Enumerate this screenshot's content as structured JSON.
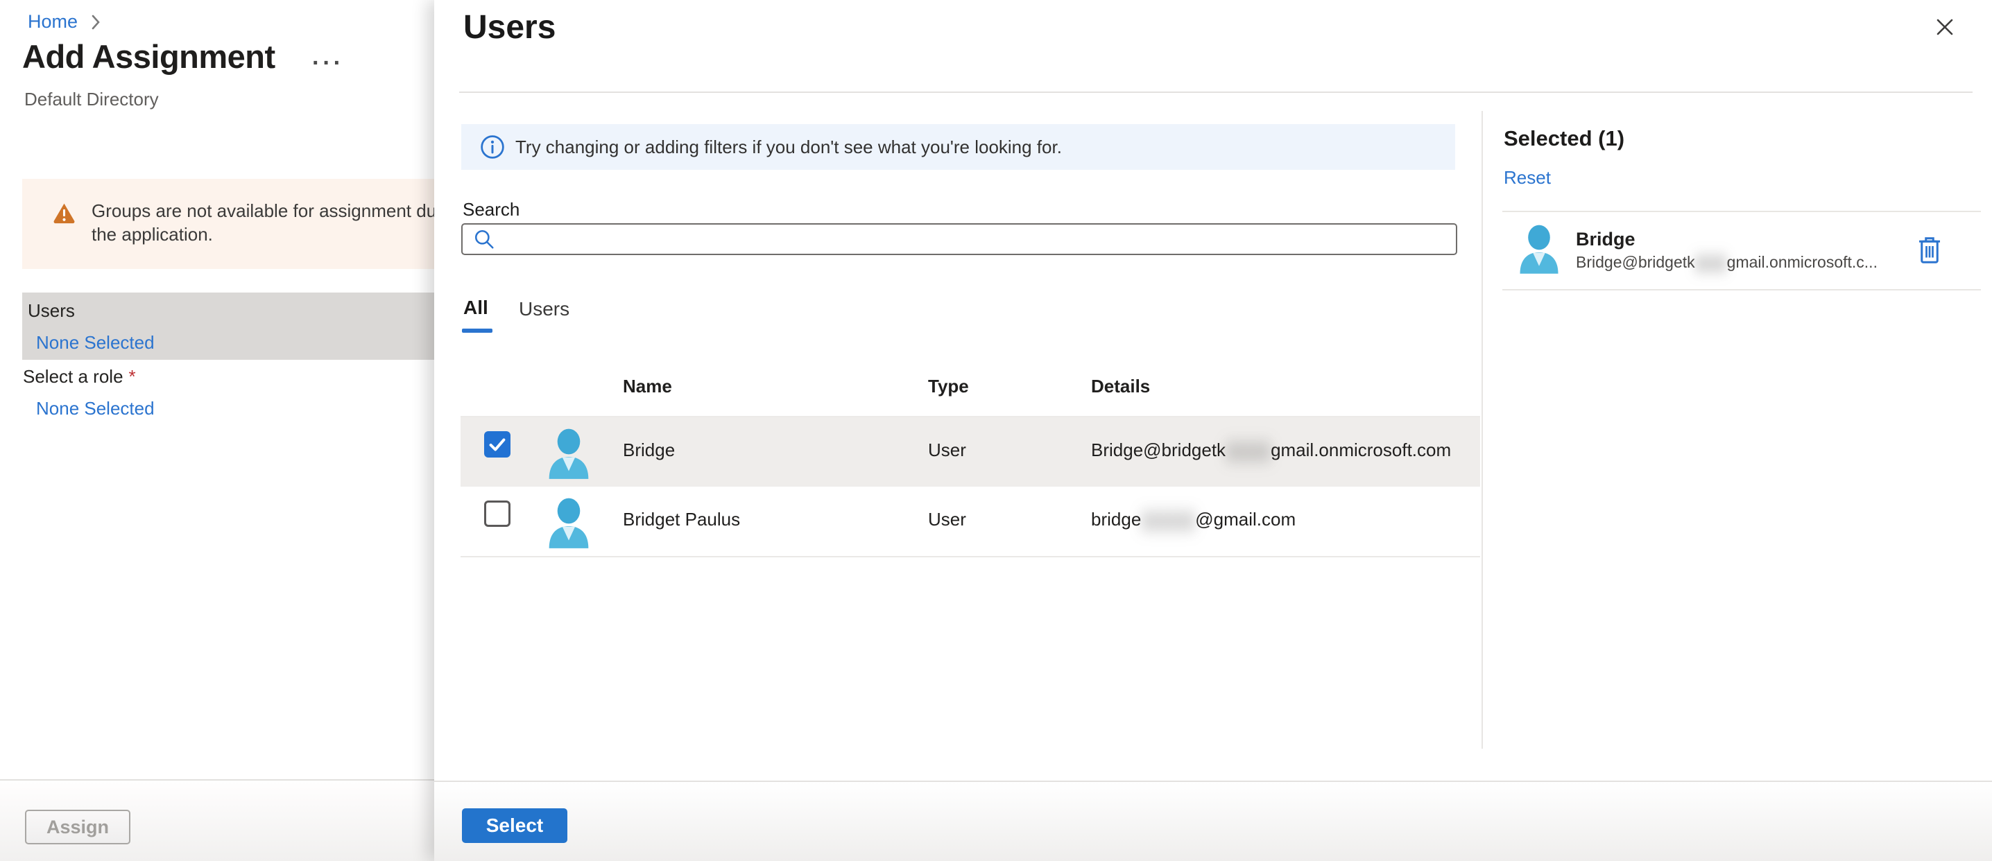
{
  "colors": {
    "accent_link": "#2b74cf",
    "primary_button": "#2374cc",
    "checkbox_checked": "#2272d3",
    "warning_banner_bg": "#fdf3ec",
    "warning_icon": "#cf7428",
    "info_banner_bg": "#eef4fc",
    "selected_row_bg": "#efedeb",
    "selected_field_bg": "#dad8d6",
    "avatar_blue": "#47afda"
  },
  "icons": {
    "more_options": "···"
  },
  "page": {
    "breadcrumb_home": "Home",
    "title": "Add Assignment",
    "subtitle": "Default Directory",
    "warning_message": "Groups are not available for assignment due to the application.",
    "users_field": {
      "label": "Users",
      "value": "None Selected"
    },
    "role_field": {
      "label": "Select a role",
      "required_mark": "*",
      "value": "None Selected"
    },
    "assign_button": "Assign"
  },
  "panel": {
    "title": "Users",
    "info_banner": "Try changing or adding filters if you don't see what you're looking for.",
    "search_label": "Search",
    "search_value": "",
    "tabs": {
      "all": "All",
      "users": "Users"
    },
    "table": {
      "columns": {
        "name": "Name",
        "type": "Type",
        "details": "Details"
      },
      "rows": [
        {
          "checked": true,
          "name": "Bridge",
          "type": "User",
          "details_prefix": "Bridge@bridgetk",
          "details_redacted": "xxxxx",
          "details_suffix": "gmail.onmicrosoft.com"
        },
        {
          "checked": false,
          "name": "Bridget Paulus",
          "type": "User",
          "details_prefix": "bridge",
          "details_redacted": "xxxxxx",
          "details_suffix": "@gmail.com"
        }
      ]
    },
    "selected_summary": {
      "title": "Selected (1)",
      "reset_link": "Reset",
      "item": {
        "name": "Bridge",
        "email_prefix": "Bridge@bridgetk",
        "email_redacted": "xxxx",
        "email_suffix": "gmail.onmicrosoft.c..."
      }
    },
    "select_button": "Select"
  }
}
